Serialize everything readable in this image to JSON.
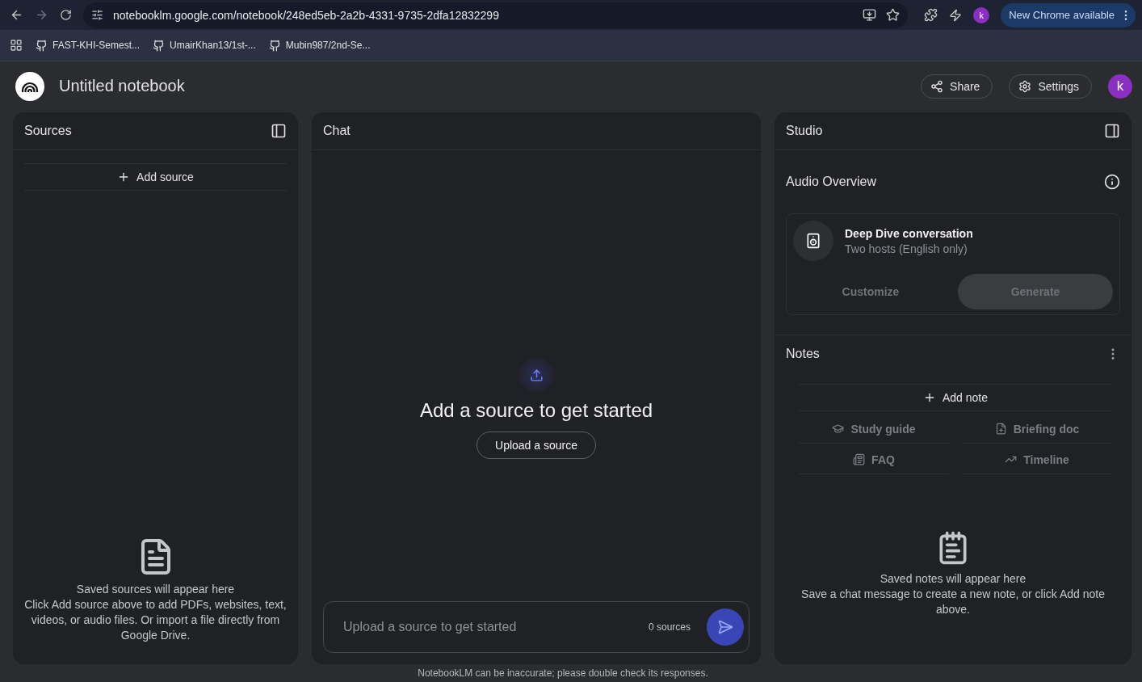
{
  "browser": {
    "url": "notebooklm.google.com/notebook/248ed5eb-2a2b-4331-9735-2dfa12832299",
    "profile": "k",
    "update_button": "New Chrome available",
    "bookmarks": [
      "FAST-KHI-Semest...",
      "UmairKhan13/1st-...",
      "Mubin987/2nd-Se..."
    ]
  },
  "header": {
    "title": "Untitled notebook",
    "buttons": [
      {
        "kind": "share",
        "label": "Share"
      },
      {
        "kind": "settings",
        "label": "Settings"
      }
    ],
    "avatar": "k"
  },
  "sources": {
    "title": "Sources",
    "add_button": "Add source",
    "empty_title": "Saved sources will appear here",
    "empty_text": "Click Add source above to add PDFs, websites, text, videos, or audio files. Or import a file directly from Google Drive."
  },
  "chat": {
    "title": "Chat",
    "heading": "Add a source to get started",
    "upload_button": "Upload a source",
    "input": {
      "placeholder": "Upload a source to get started"
    },
    "count": "0 sources"
  },
  "studio": {
    "title": "Studio",
    "audio": {
      "title": "Audio Overview",
      "card_title": "Deep Dive conversation",
      "card_subtitle": "Two hosts (English only)",
      "buttons": [
        {
          "kind": "text",
          "label": "Customize",
          "disabled": true
        },
        {
          "kind": "filled",
          "label": "Generate",
          "disabled": true
        }
      ]
    },
    "notes": {
      "title": "Notes",
      "add_button": "Add note",
      "actions": [
        {
          "kind": "study",
          "label": "Study guide",
          "disabled": true
        },
        {
          "kind": "briefing",
          "label": "Briefing doc",
          "disabled": true
        },
        {
          "kind": "faq",
          "label": "FAQ",
          "disabled": true
        },
        {
          "kind": "timeline",
          "label": "Timeline",
          "disabled": true
        }
      ],
      "empty_title": "Saved notes will appear here",
      "empty_text": "Save a chat message to create a new note, or click Add note above."
    }
  },
  "footer": "NotebookLM can be inaccurate; please double check its responses."
}
